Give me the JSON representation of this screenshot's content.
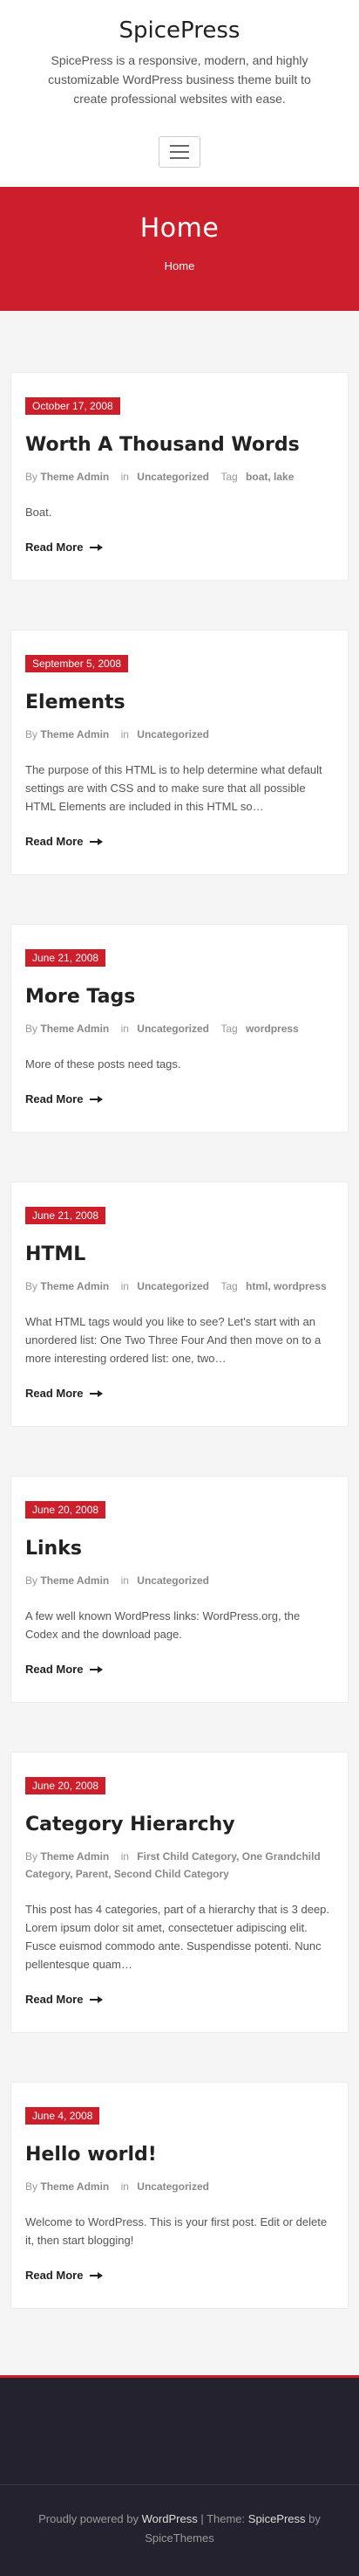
{
  "site": {
    "title": "SpicePress",
    "description": "SpicePress is a responsive, modern, and highly customizable WordPress business theme built to create professional websites with ease."
  },
  "banner": {
    "title": "Home",
    "breadcrumb": "Home"
  },
  "labels": {
    "by": "By",
    "in": "in",
    "tag": "Tag",
    "read_more": "Read More"
  },
  "posts": [
    {
      "date": "October 17, 2008",
      "title": "Worth A Thousand Words",
      "author": "Theme Admin",
      "categories": "Uncategorized",
      "tags": "boat, lake",
      "excerpt": "Boat."
    },
    {
      "date": "September 5, 2008",
      "title": "Elements",
      "author": "Theme Admin",
      "categories": "Uncategorized",
      "tags": "",
      "excerpt": "The purpose of this HTML is to help determine what default settings are with CSS and to make sure that all possible HTML Elements are included in this HTML so…"
    },
    {
      "date": "June 21, 2008",
      "title": "More Tags",
      "author": "Theme Admin",
      "categories": "Uncategorized",
      "tags": "wordpress",
      "excerpt": "More of these posts need tags."
    },
    {
      "date": "June 21, 2008",
      "title": "HTML",
      "author": "Theme Admin",
      "categories": "Uncategorized",
      "tags": "html, wordpress",
      "excerpt": "What HTML tags would you like to see? Let's start with an unordered list: One Two Three Four And then move on to a more interesting ordered list: one, two…"
    },
    {
      "date": "June 20, 2008",
      "title": "Links",
      "author": "Theme Admin",
      "categories": "Uncategorized",
      "tags": "",
      "excerpt": "A few well known WordPress links: WordPress.org, the Codex and the download page."
    },
    {
      "date": "June 20, 2008",
      "title": "Category Hierarchy",
      "author": "Theme Admin",
      "categories": "First Child Category, One Grandchild Category, Parent, Second Child Category",
      "tags": "",
      "excerpt": "This post has 4 categories, part of a hierarchy that is 3 deep. Lorem ipsum dolor sit amet, consectetuer adipiscing elit. Fusce euismod commodo ante. Suspendisse potenti. Nunc pellentesque quam…"
    },
    {
      "date": "June 4, 2008",
      "title": "Hello world!",
      "author": "Theme Admin",
      "categories": "Uncategorized",
      "tags": "",
      "excerpt": "Welcome to WordPress. This is your first post. Edit or delete it, then start blogging!"
    }
  ],
  "footer": {
    "prefix": "Proudly powered by",
    "wordpress": "WordPress",
    "theme_label": "| Theme:",
    "theme": "SpicePress",
    "by": "by",
    "author": "SpiceThemes"
  },
  "colors": {
    "accent": "#cc1f2b",
    "footer_bg": "#23222e"
  }
}
